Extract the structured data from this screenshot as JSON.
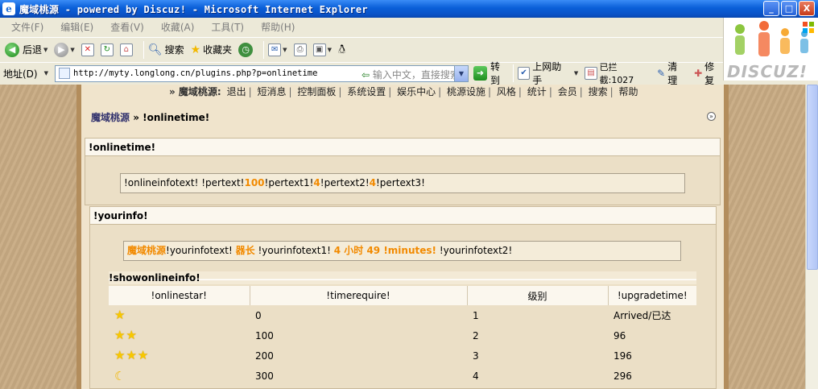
{
  "window": {
    "title": "魔域桃源 - powered by Discuz! - Microsoft Internet Explorer",
    "controls": [
      "_",
      "□",
      "X"
    ]
  },
  "menu": [
    "文件(F)",
    "编辑(E)",
    "查看(V)",
    "收藏(A)",
    "工具(T)",
    "帮助(H)"
  ],
  "toolbar": {
    "back": "后退",
    "search": "搜索",
    "favorites": "收藏夹"
  },
  "logo": {
    "text": "DISCUZ!"
  },
  "address": {
    "label": "地址(D)",
    "url": "http://myty.longlong.cn/plugins.php?p=onlinetime",
    "hint": "输入中文，直接搜索",
    "go": "转到",
    "assistant": "上网助手",
    "blocked": "已拦截:1027",
    "clean": "清理",
    "repair": "修复"
  },
  "topnav": {
    "site": "» 魔域桃源:",
    "items": [
      "退出",
      "短消息",
      "控制面板",
      "系统设置",
      "娱乐中心",
      "桃源设施",
      "风格",
      "统计",
      "会员",
      "搜索",
      "帮助"
    ]
  },
  "breadcrumb": {
    "home": "魔域桃源",
    "sep": " » ",
    "current": "!onlinetime!"
  },
  "onlinebox": {
    "title": "!onlinetime!",
    "line": {
      "t1": "!onlineinfotext! !pertext!",
      "v1": "100",
      "t2": "!pertext1!",
      "v2": "4",
      "t3": "!pertext2!",
      "v3": "4",
      "t4": "!pertext3!"
    }
  },
  "yourinfo": {
    "title": "!yourinfo!",
    "line": {
      "site": "魔域桃源",
      "t1": "!yourinfotext!",
      "role": "器长",
      "t2": "!yourinfotext1!",
      "time": "4 小时 49 !minutes!",
      "t3": "!yourinfotext2!"
    }
  },
  "showonline": {
    "title": "!showonlineinfo!",
    "headers": [
      "!onlinestar!",
      "!timerequire!",
      "级别",
      "!upgradetime!"
    ],
    "rows": [
      {
        "stars": 1,
        "icon": "star",
        "time": "0",
        "level": "1",
        "upgrade": "Arrived/已达"
      },
      {
        "stars": 2,
        "icon": "star",
        "time": "100",
        "level": "2",
        "upgrade": "96"
      },
      {
        "stars": 3,
        "icon": "star",
        "time": "200",
        "level": "3",
        "upgrade": "196"
      },
      {
        "stars": 1,
        "icon": "moon",
        "time": "300",
        "level": "4",
        "upgrade": "296"
      }
    ]
  }
}
